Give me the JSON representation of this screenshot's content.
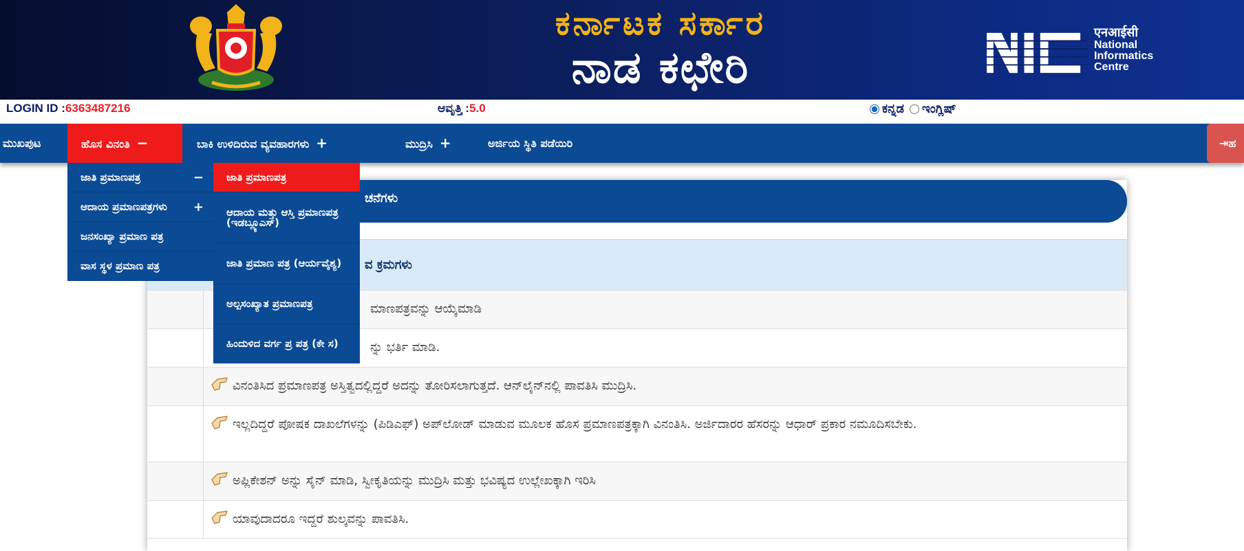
{
  "header": {
    "title_top": "ಕರ್ನಾಟಕ ಸರ್ಕಾರ",
    "title_main": "ನಾಡ ಕಛೇರಿ",
    "nic_hindi": "एनआईसी",
    "nic_line1": "National",
    "nic_line2": "Informatics",
    "nic_line3": "Centre"
  },
  "info": {
    "login_label": "LOGIN ID :",
    "login_value": "6363487216",
    "version_label": "ಆವೃತ್ತಿ :",
    "version_value": "5.0",
    "lang_kannada": "ಕನ್ನಡ",
    "lang_english": "ಇಂಗ್ಲಿಷ್",
    "lang_selected": "kannada"
  },
  "nav": {
    "home": "ಮುಖಪುಟ",
    "new_request": "ಹೊಸ ವಿನಂತಿ",
    "new_request_sign": "−",
    "pending": "ಬಾಕಿ ಉಳಿದಿರುವ ವ್ಯವಹಾರಗಳು",
    "pending_sign": "+",
    "print": "ಮುದ್ರಿಸಿ",
    "print_sign": "+",
    "app_status": "ಅರ್ಜಿಯ ಸ್ಥಿತಿ ಪಡೆಯಿರಿ",
    "logout": "ಹ"
  },
  "dropdown1": [
    {
      "label": "ಜಾತಿ ಪ್ರಮಾಣಪತ್ರ",
      "sign": "−"
    },
    {
      "label": "ಆದಾಯ ಪ್ರಮಾಣಪತ್ರಗಳು",
      "sign": "+"
    },
    {
      "label": "ಜನಸಂಖ್ಯಾ ಪ್ರಮಾಣ ಪತ್ರ",
      "sign": ""
    },
    {
      "label": "ವಾಸ ಸ್ಥಳ ಪ್ರಮಾಣ ಪತ್ರ",
      "sign": ""
    }
  ],
  "dropdown2": [
    {
      "label": "ಜಾತಿ ಪ್ರಮಾಣಪತ್ರ"
    },
    {
      "label": "ಆದಾಯ ಮತ್ತು ಆಸ್ತಿ ಪ್ರಮಾಣಪತ್ರ (ಇಡಬ್ಲ್ಯೂಎಸ್)"
    },
    {
      "label": "ಜಾತಿ ಪ್ರಮಾಣ ಪತ್ರ (ಆರ್ಯವೈಶ್ಯ)"
    },
    {
      "label": "ಅಲ್ಪಸಂಖ್ಯಾತ ಪ್ರಮಾಣಪತ್ರ"
    },
    {
      "label": "ಹಿಂದುಳಿದ ವರ್ಗ ಪ್ರ ಪತ್ರ (ಕೇ ಸ)"
    }
  ],
  "panel": {
    "header": "ಚನೆಗಳು",
    "subheader": "ವ ಕ್ರಮಗಳು",
    "rows": [
      "ಮಾಣಪತ್ರವನ್ನು ಆಯ್ಕೆಮಾಡಿ",
      "ನ್ನು ಭರ್ತಿ ಮಾಡಿ.",
      "ವಿನಂತಿಸಿದ ಪ್ರಮಾಣಪತ್ರ ಅಸ್ತಿತ್ವದಲ್ಲಿದ್ದರೆ ಅದನ್ನು ತೋರಿಸಲಾಗುತ್ತದೆ. ಆನ್‌ಲೈನ್‌ನಲ್ಲಿ ಪಾವತಿಸಿ ಮುದ್ರಿಸಿ.",
      "ಇಲ್ಲದಿದ್ದರೆ ಪೋಷಕ ದಾಖಲೆಗಳನ್ನು (ಪಿಡಿಎಫ್) ಅಪ್‌ಲೋಡ್ ಮಾಡುವ ಮೂಲಕ ಹೊಸ ಪ್ರಮಾಣಪತ್ರಕ್ಕಾಗಿ ವಿನಂತಿಸಿ. ಅರ್ಜಿದಾರರ ಹೆಸರನ್ನು ಆಧಾರ್ ಪ್ರಕಾರ ನಮೂದಿಸಬೇಕು.",
      "ಅಪ್ಲಿಕೇಶನ್ ಅನ್ನು ಸೈನ್ ಮಾಡಿ, ಸ್ವೀಕೃತಿಯನ್ನು ಮುದ್ರಿಸಿ ಮತ್ತು ಭವಿಷ್ಯದ ಉಲ್ಲೇಖಕ್ಕಾಗಿ ಇರಿಸಿ",
      "ಯಾವುದಾದರೂ ಇದ್ದರೆ ಶುಲ್ಕವನ್ನು ಪಾವತಿಸಿ."
    ]
  },
  "colors": {
    "nav_blue": "#0b4a94",
    "active_red": "#ef1b1b",
    "title_gold": "#f2b319"
  }
}
